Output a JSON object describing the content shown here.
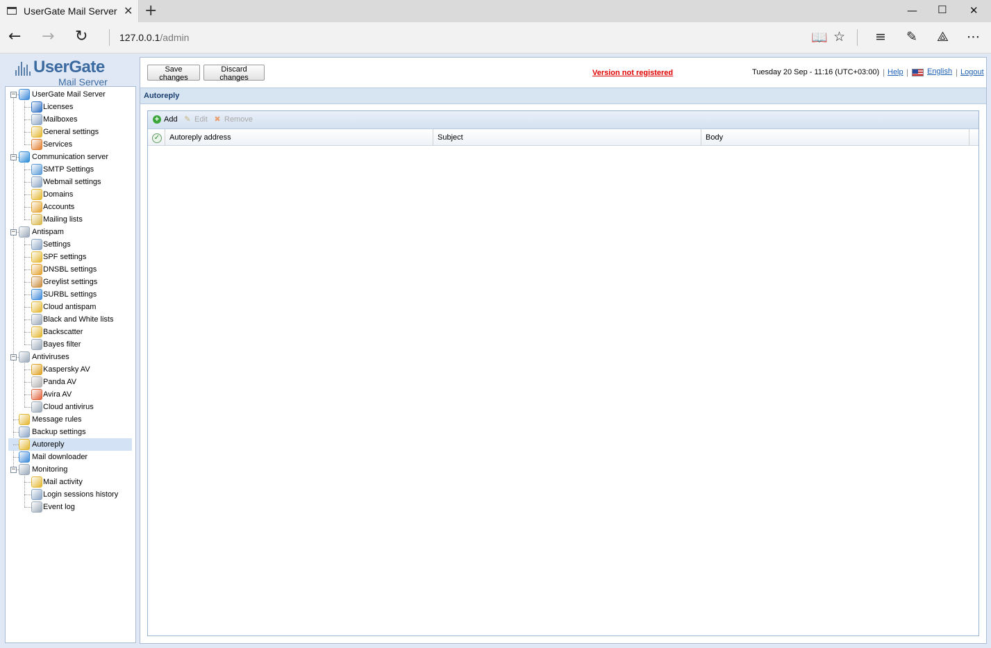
{
  "browser": {
    "tab_title": "UserGate Mail Server",
    "url_host": "127.0.0.1",
    "url_path": "/admin"
  },
  "app": {
    "logo_name": "UserGate",
    "logo_sub": "Mail Server"
  },
  "toolbar": {
    "save_label": "Save changes",
    "discard_label": "Discard changes",
    "version_status": "Version not registered",
    "datetime": "Tuesday 20 Sep - 11:16 (UTC+03:00)",
    "help_label": "Help",
    "language_label": "English",
    "logout_label": "Logout"
  },
  "sidebar": {
    "items": [
      {
        "label": "UserGate Mail Server",
        "level": 0,
        "toggle": "minus",
        "icon_color": "#3a88d8"
      },
      {
        "label": "Licenses",
        "level": 1,
        "icon_color": "#2d6fc4"
      },
      {
        "label": "Mailboxes",
        "level": 1,
        "icon_color": "#8aa4c4"
      },
      {
        "label": "General settings",
        "level": 1,
        "icon_color": "#e3b62e"
      },
      {
        "label": "Services",
        "level": 1,
        "icon_color": "#e07b2a"
      },
      {
        "label": "Communication server",
        "level": 0,
        "toggle": "minus",
        "icon_color": "#2a8ad8"
      },
      {
        "label": "SMTP Settings",
        "level": 1,
        "icon_color": "#5a9ad8"
      },
      {
        "label": "Webmail settings",
        "level": 1,
        "icon_color": "#8aa4c4"
      },
      {
        "label": "Domains",
        "level": 1,
        "icon_color": "#e3b62e"
      },
      {
        "label": "Accounts",
        "level": 1,
        "icon_color": "#e3a12e"
      },
      {
        "label": "Mailing lists",
        "level": 1,
        "icon_color": "#d9b548"
      },
      {
        "label": "Antispam",
        "level": 0,
        "toggle": "minus",
        "icon_color": "#9aa8b8"
      },
      {
        "label": "Settings",
        "level": 1,
        "icon_color": "#8aa4c4"
      },
      {
        "label": "SPF settings",
        "level": 1,
        "icon_color": "#e3b62e"
      },
      {
        "label": "DNSBL settings",
        "level": 1,
        "icon_color": "#e3a12e"
      },
      {
        "label": "Greylist settings",
        "level": 1,
        "icon_color": "#c98a3a"
      },
      {
        "label": "SURBL settings",
        "level": 1,
        "icon_color": "#3a88d8"
      },
      {
        "label": "Cloud antispam",
        "level": 1,
        "icon_color": "#e3b62e"
      },
      {
        "label": "Black and White lists",
        "level": 1,
        "icon_color": "#9aa8b8"
      },
      {
        "label": "Backscatter",
        "level": 1,
        "icon_color": "#e3b62e"
      },
      {
        "label": "Bayes filter",
        "level": 1,
        "icon_color": "#9aa8b8"
      },
      {
        "label": "Antiviruses",
        "level": 0,
        "toggle": "minus",
        "icon_color": "#9aa8b8"
      },
      {
        "label": "Kaspersky AV",
        "level": 1,
        "icon_color": "#e0a020"
      },
      {
        "label": "Panda AV",
        "level": 1,
        "icon_color": "#b0b0b0"
      },
      {
        "label": "Avira AV",
        "level": 1,
        "icon_color": "#e0603a"
      },
      {
        "label": "Cloud antivirus",
        "level": 1,
        "icon_color": "#9aa8b8"
      },
      {
        "label": "Message rules",
        "level": 0,
        "icon_color": "#e3b62e"
      },
      {
        "label": "Backup settings",
        "level": 0,
        "icon_color": "#8aa4c4"
      },
      {
        "label": "Autoreply",
        "level": 0,
        "icon_color": "#e3b62e",
        "selected": true
      },
      {
        "label": "Mail downloader",
        "level": 0,
        "icon_color": "#3a88d8"
      },
      {
        "label": "Monitoring",
        "level": 0,
        "toggle": "minus",
        "icon_color": "#9aa8b8"
      },
      {
        "label": "Mail activity",
        "level": 1,
        "icon_color": "#e3b62e"
      },
      {
        "label": "Login sessions history",
        "level": 1,
        "icon_color": "#8aa4c4"
      },
      {
        "label": "Event log",
        "level": 1,
        "icon_color": "#9aa8b8"
      }
    ]
  },
  "content": {
    "section_title": "Autoreply",
    "actions": {
      "add_label": "Add",
      "edit_label": "Edit",
      "remove_label": "Remove"
    },
    "columns": [
      "Autoreply address",
      "Subject",
      "Body"
    ],
    "rows": []
  }
}
